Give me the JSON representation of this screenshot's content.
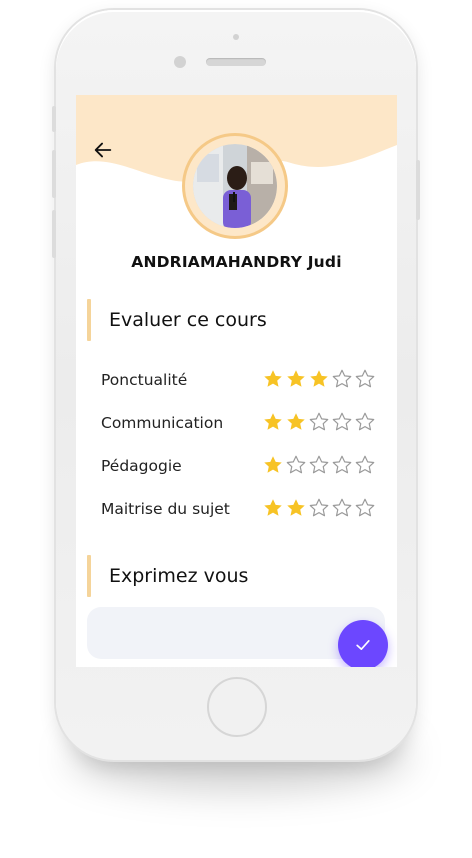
{
  "profile": {
    "name": "ANDRIAMAHANDRY Judi"
  },
  "sections": {
    "evaluate_title": "Evaluer ce cours",
    "express_title": "Exprimez vous"
  },
  "ratings": [
    {
      "label": "Ponctualité",
      "value": 3,
      "max": 5
    },
    {
      "label": "Communication",
      "value": 2,
      "max": 5
    },
    {
      "label": "Pédagogie",
      "value": 1,
      "max": 5
    },
    {
      "label": "Maitrise du sujet",
      "value": 2,
      "max": 5
    }
  ],
  "comment": {
    "value": "",
    "placeholder": ""
  },
  "icons": {
    "back": "arrow-left-icon",
    "submit": "check-icon",
    "star_filled": "star-filled-icon",
    "star_empty": "star-outline-icon"
  },
  "colors": {
    "header_wave": "#fde7c8",
    "accent_bar": "#f5d49a",
    "star": "#f7c325",
    "star_empty": "#9a9a9a",
    "fab": "#6c47ff",
    "input_bg": "#f1f3f8"
  }
}
